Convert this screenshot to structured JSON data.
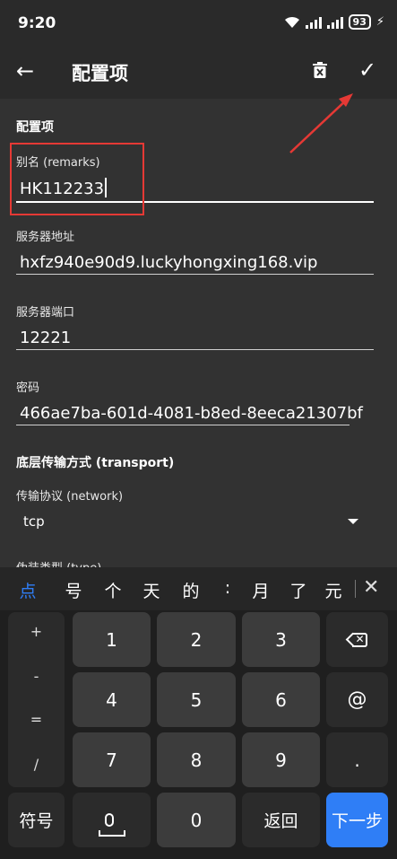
{
  "status_bar": {
    "time": "9:20",
    "battery": "93"
  },
  "app_bar": {
    "back_icon": "arrow-left-icon",
    "title": "配置项",
    "delete_icon": "trash-icon",
    "confirm_icon": "check-icon"
  },
  "form": {
    "section_title": "配置项",
    "remarks": {
      "label": "别名 (remarks)",
      "value": "HK112233"
    },
    "server_address": {
      "label": "服务器地址",
      "value": "hxfz940e90d9.luckyhongxing168.vip"
    },
    "server_port": {
      "label": "服务器端口",
      "value": "12221"
    },
    "password": {
      "label": "密码",
      "value": "466ae7ba-601d-4081-b8ed-8eeca21307bf"
    },
    "transport_section": "底层传输方式 (transport)",
    "network": {
      "label": "传输协议 (network)",
      "value": "tcp"
    },
    "partial_next_label": "伪装类型 (type)"
  },
  "keyboard": {
    "candidates": [
      "点",
      "号",
      "个",
      "天",
      "的",
      ":",
      "月",
      "了",
      "元"
    ],
    "symbols": [
      "+",
      "-",
      "=",
      "/"
    ],
    "digits": [
      "1",
      "2",
      "3",
      "4",
      "5",
      "6",
      "7",
      "8",
      "9",
      "0"
    ],
    "at_key": "@",
    "dot_key": ".",
    "symbols_key": "符号",
    "back_key": "返回",
    "next_key": "下一步"
  },
  "colors": {
    "background": "#323232",
    "annotation": "#e53935",
    "accent": "#2f7ef6"
  }
}
